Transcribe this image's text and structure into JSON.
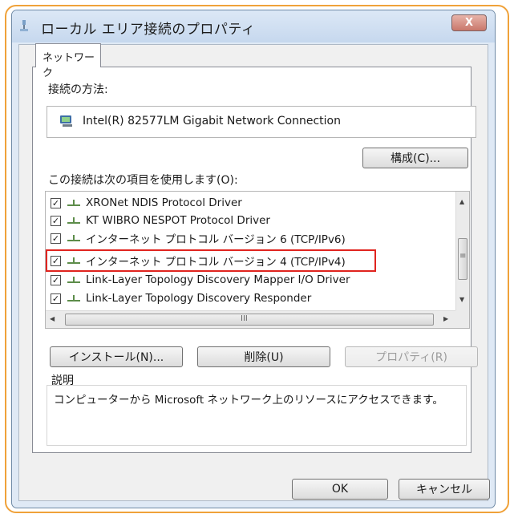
{
  "window": {
    "title": "ローカル エリア接続のプロパティ",
    "close_label": "X"
  },
  "tab": {
    "label": "ネットワーク"
  },
  "connect_using": {
    "label": "接続の方法:",
    "adapter_name": "Intel(R) 82577LM Gigabit Network Connection"
  },
  "configure_button": "構成(C)...",
  "items_label": "この接続は次の項目を使用します(O):",
  "items": [
    {
      "label": "XRONet NDIS Protocol Driver",
      "checked": true
    },
    {
      "label": "KT WIBRO NESPOT Protocol Driver",
      "checked": true
    },
    {
      "label": "インターネット プロトコル バージョン 6 (TCP/IPv6)",
      "checked": true
    },
    {
      "label": "インターネット プロトコル バージョン 4 (TCP/IPv4)",
      "checked": true
    },
    {
      "label": "Link-Layer Topology Discovery Mapper I/O Driver",
      "checked": true
    },
    {
      "label": "Link-Layer Topology Discovery Responder",
      "checked": true
    }
  ],
  "scrollbar": {
    "h_grip": "III",
    "v_grip": "≡"
  },
  "buttons": {
    "install": "インストール(N)...",
    "uninstall": "削除(U)",
    "properties": "プロパティ(R)"
  },
  "description": {
    "label": "説明",
    "text": "コンピューターから Microsoft ネットワーク上のリソースにアクセスできます。"
  },
  "footer": {
    "ok": "OK",
    "cancel": "キャンセル"
  },
  "colors": {
    "highlight": "#e0241f",
    "frame": "#f0a23a"
  }
}
